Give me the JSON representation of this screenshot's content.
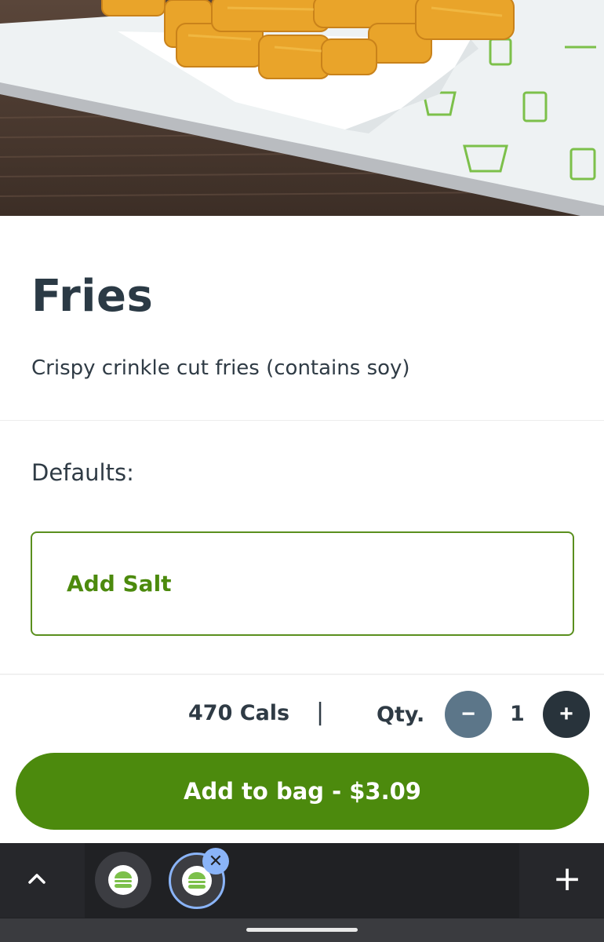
{
  "product": {
    "title": "Fries",
    "description": "Crispy crinkle cut fries (contains soy)"
  },
  "options": {
    "section_label": "Defaults:",
    "items": [
      {
        "label": "Add Salt"
      }
    ]
  },
  "footer": {
    "calories": "470 Cals",
    "separator": "|",
    "qty_label": "Qty.",
    "qty_value": "1",
    "minus_symbol": "−",
    "plus_symbol": "+",
    "add_to_bag": "Add to bag - $3.09"
  },
  "browser_bar": {
    "chevron_icon": "chevron-up-icon",
    "new_tab_symbol": "+",
    "close_symbol": "✕",
    "tabs": [
      "burger-logo-icon",
      "burger-logo-icon"
    ]
  },
  "colors": {
    "brand_green": "#4c8a0d",
    "text_dark": "#2b3a45",
    "qty_minus": "#5c7689",
    "qty_plus": "#28333b",
    "active_tab_ring": "#8ab4f8"
  }
}
